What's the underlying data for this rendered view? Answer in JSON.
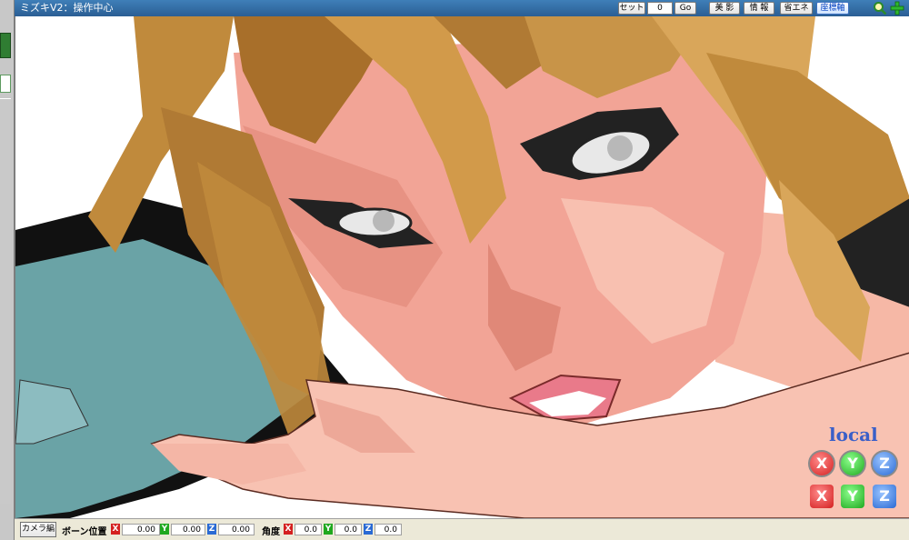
{
  "window": {
    "title": "ミズキV2：操作中心"
  },
  "toolbar": {
    "set_label": "セット",
    "set_value": "0",
    "go_label": "Go",
    "beauty_label": "美 影",
    "info_label": "情 報",
    "energy_label": "省エネ",
    "axis_label": "座標軸"
  },
  "viewport": {
    "coord_mode": "local",
    "axis_x": "X",
    "axis_y": "Y",
    "axis_z": "Z"
  },
  "statusbar": {
    "mode_button": "カメラ編",
    "bone_position_label": "ボーン位置",
    "position": {
      "x": "0.00",
      "y": "0.00",
      "z": "0.00"
    },
    "angle_label": "角度",
    "angle": {
      "x": "0.0",
      "y": "0.0",
      "z": "0.0"
    },
    "axis_tags": {
      "x": "X",
      "y": "Y",
      "z": "Z"
    }
  },
  "icons": [
    "zoom-icon",
    "move-plus-icon"
  ],
  "colors": {
    "titlebar": "#2a5e94",
    "skin": "#f2a496",
    "hair": "#c08a3c",
    "cloth": "#6aa0a4"
  }
}
